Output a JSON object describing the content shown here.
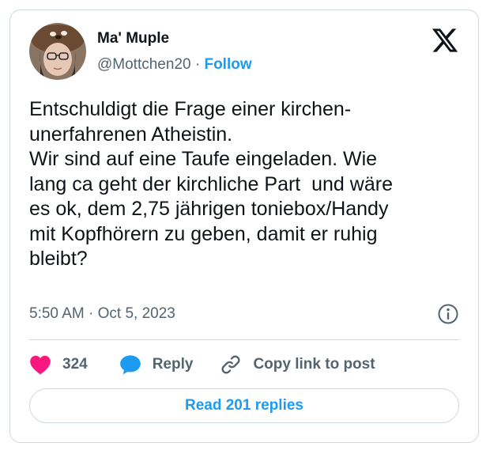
{
  "author": {
    "name": "Ma' Muple",
    "handle": "@Mottchen20",
    "separator": "·",
    "follow_label": "Follow"
  },
  "tweet": {
    "text": "Entschuldigt die Frage einer kirchen-\nunerfahrenen Atheistin.\nWir sind auf eine Taufe eingeladen. Wie\nlang ca geht der kirchliche Part  und wäre\nes ok, dem 2,75 jährigen toniebox/Handy\nmit Kopfhörern zu geben, damit er ruhig\nbleibt?",
    "time": "5:50 AM",
    "separator": "·",
    "date": "Oct 5, 2023"
  },
  "actions": {
    "like_count": "324",
    "reply_label": "Reply",
    "copy_label": "Copy link to post"
  },
  "read_replies_label": "Read 201 replies",
  "icons": {
    "platform": "x-logo-icon",
    "info": "info-icon",
    "like": "heart-icon",
    "reply": "speech-bubble-icon",
    "copy": "link-icon"
  },
  "colors": {
    "accent": "#1d9bf0",
    "heart": "#f91880",
    "secondary_text": "#536471",
    "border": "#cfd9de"
  }
}
